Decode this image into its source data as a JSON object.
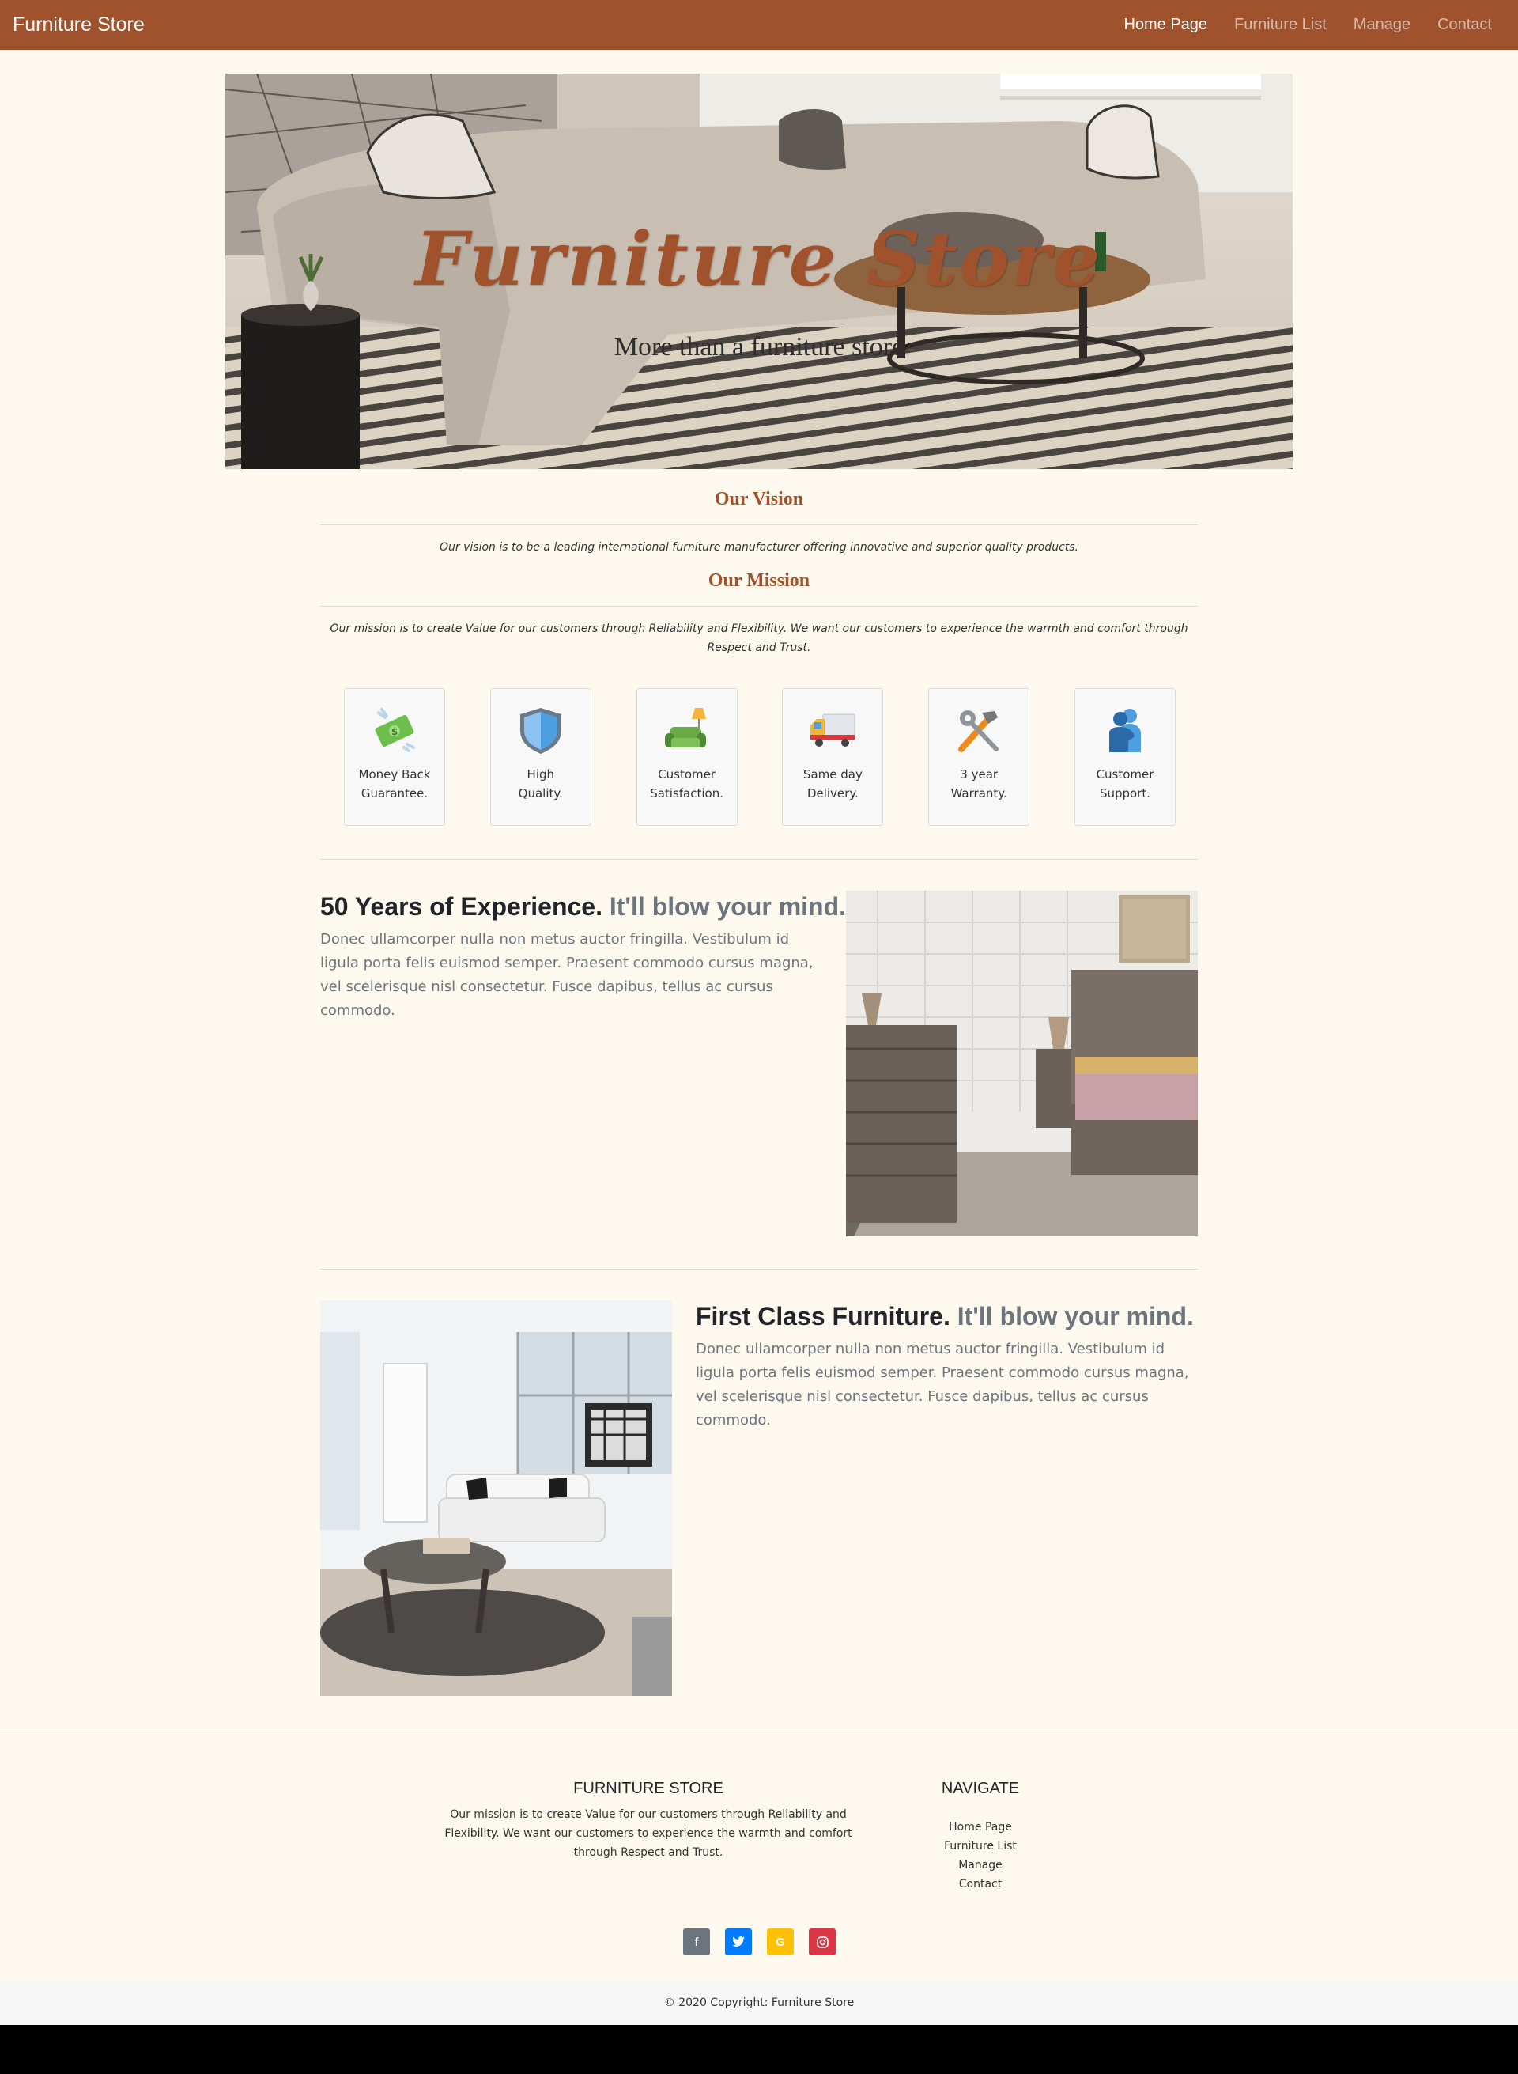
{
  "navbar": {
    "brand": "Furniture Store",
    "links": [
      {
        "label": "Home Page",
        "active": true
      },
      {
        "label": "Furniture List",
        "active": false
      },
      {
        "label": "Manage",
        "active": false
      },
      {
        "label": "Contact",
        "active": false
      }
    ]
  },
  "hero": {
    "title": "Furniture Store",
    "subtitle": "More than a furniture store"
  },
  "vision": {
    "title": "Our Vision",
    "text": "Our vision is to be a leading international furniture manufacturer offering innovative and superior quality products."
  },
  "mission": {
    "title": "Our Mission",
    "text": "Our mission is to create Value for our customers through Reliability and Flexibility. We want our customers to experience the warmth and comfort through Respect and Trust."
  },
  "features": [
    {
      "icon": "money-icon",
      "label": "Money Back Guarantee."
    },
    {
      "icon": "shield-icon",
      "label": "High Quality."
    },
    {
      "icon": "sofa-lamp-icon",
      "label": "Customer Satisfaction."
    },
    {
      "icon": "delivery-truck-icon",
      "label": "Same day Delivery."
    },
    {
      "icon": "tools-icon",
      "label": "3 year Warranty."
    },
    {
      "icon": "hug-icon",
      "label": "Customer Support."
    }
  ],
  "featurettes": [
    {
      "heading": "50 Years of Experience.",
      "heading_muted": "It'll blow your mind.",
      "text": "Donec ullamcorper nulla non metus auctor fringilla. Vestibulum id ligula porta felis euismod semper. Praesent commodo cursus magna, vel scelerisque nisl consectetur. Fusce dapibus, tellus ac cursus commodo."
    },
    {
      "heading": "First Class Furniture.",
      "heading_muted": "It'll blow your mind.",
      "text": "Donec ullamcorper nulla non metus auctor fringilla. Vestibulum id ligula porta felis euismod semper. Praesent commodo cursus magna, vel scelerisque nisl consectetur. Fusce dapibus, tellus ac cursus commodo."
    }
  ],
  "footer": {
    "about_title": "FURNITURE STORE",
    "about_text": "Our mission is to create Value for our customers through Reliability and Flexibility. We want our customers to experience the warmth and comfort through Respect and Trust.",
    "nav_title": "NAVIGATE",
    "nav_links": [
      "Home Page",
      "Furniture List",
      "Manage",
      "Contact"
    ],
    "socials": [
      {
        "icon": "facebook-icon",
        "glyph": "f",
        "color": "#6c757d"
      },
      {
        "icon": "twitter-icon",
        "glyph": "t",
        "color": "#007bff"
      },
      {
        "icon": "google-icon",
        "glyph": "G",
        "color": "#ffc107"
      },
      {
        "icon": "instagram-icon",
        "glyph": "◎",
        "color": "#dc3545"
      }
    ],
    "copyright": "© 2020 Copyright: Furniture Store"
  },
  "colors": {
    "brand": "#a0522d",
    "page_bg": "#fef9ee"
  }
}
